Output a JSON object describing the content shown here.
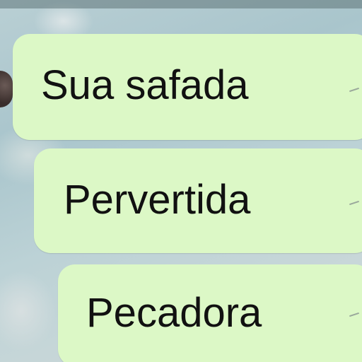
{
  "messages": [
    {
      "text": "Sua safada"
    },
    {
      "text": "Pervertida"
    },
    {
      "text": "Pecadora"
    }
  ],
  "colors": {
    "bubble": "#dcf8c6",
    "text": "#111111",
    "background": "#b9cfd4"
  }
}
